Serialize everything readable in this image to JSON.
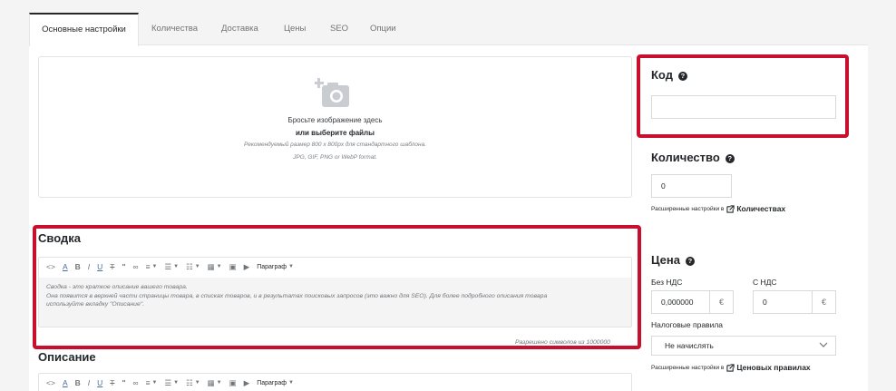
{
  "tabs": [
    {
      "label": "Основные настройки"
    },
    {
      "label": "Количества"
    },
    {
      "label": "Доставка"
    },
    {
      "label": "Цены"
    },
    {
      "label": "SEO"
    },
    {
      "label": "Опции"
    }
  ],
  "dropzone": {
    "line1": "Бросьте изображение здесь",
    "line2": "или выберите файлы",
    "line3": "Рекомендуемый размер 800 x 800px для стандартного шаблона.",
    "line4": "JPG, GIF, PNG or WebP format.",
    "icon": "add-image-icon"
  },
  "summary": {
    "title": "Сводка",
    "toolbar_paragraph": "Параграф",
    "text_line1": "Сводка - это краткое описание вашего товара.",
    "text_line2": "Она появится в верхней части страницы товара, в списках товаров, и в результатах поисковых запросов (это важно для SEO). Для более подробного описания товара",
    "text_line3": "используйте вкладку \"Описание\".",
    "counter": "Разрешено символов из 1000000"
  },
  "description": {
    "title": "Описание",
    "toolbar_paragraph": "Параграф"
  },
  "code": {
    "title": "Код",
    "value": ""
  },
  "quantity": {
    "title": "Количество",
    "value": "0",
    "note": "Расширенные настройки в",
    "link": "Количествах"
  },
  "price": {
    "title": "Цена",
    "without_vat_label": "Без НДС",
    "with_vat_label": "С НДС",
    "without_vat_value": "0,000000",
    "with_vat_value": "0",
    "currency": "€",
    "tax_label": "Налоговые правила",
    "tax_value": "Не начислять",
    "note": "Расширенные настройки в",
    "link": "Ценовых правилах"
  },
  "colors": {
    "highlight": "#c8102e",
    "text": "#25282b",
    "muted": "#6f7478",
    "editor_bg": "#f4f4f5"
  }
}
